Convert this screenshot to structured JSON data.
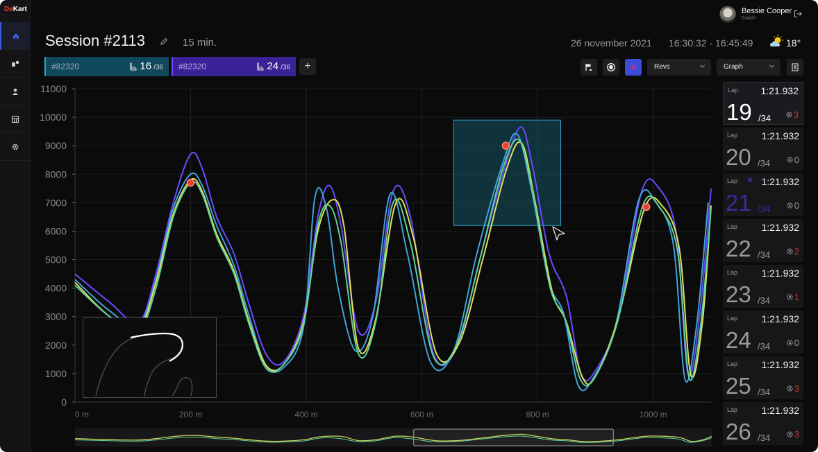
{
  "app": {
    "logo_main": "De",
    "logo_accent": "Kart"
  },
  "sidebar": {
    "items": [
      {
        "name": "home",
        "active": true
      },
      {
        "name": "karts",
        "active": false
      },
      {
        "name": "drivers",
        "active": false
      },
      {
        "name": "calendar",
        "active": false
      },
      {
        "name": "settings",
        "active": false
      }
    ]
  },
  "user": {
    "name": "Bessie Cooper",
    "role": "Coach"
  },
  "header": {
    "title": "Session #2113",
    "duration": "15 min.",
    "date": "26 november 2021",
    "time_range": "16:30:32 - 16:45:49",
    "temperature": "18°"
  },
  "tabs": [
    {
      "id": "#82320",
      "laps_current": "16",
      "laps_total": "/36",
      "color": "#10495e"
    },
    {
      "id": "#82320",
      "laps_current": "24",
      "laps_total": "/36",
      "color": "#3a2397"
    }
  ],
  "toolbar": {
    "metric_select": "Revs",
    "view_select": "Graph"
  },
  "chart_data": {
    "type": "line",
    "xlabel": "",
    "ylabel": "",
    "xlim": [
      0,
      1100
    ],
    "ylim": [
      0,
      11000
    ],
    "x_ticks": [
      "0 m",
      "200 m",
      "400 m",
      "600 m",
      "800 m",
      "1000 m"
    ],
    "x_tick_values": [
      0,
      200,
      400,
      600,
      800,
      1000
    ],
    "y_ticks": [
      "11000",
      "10000",
      "9000",
      "8000",
      "7000",
      "6000",
      "5000",
      "4000",
      "3000",
      "2000",
      "1000",
      "0"
    ],
    "y_tick_values": [
      11000,
      10000,
      9000,
      8000,
      7000,
      6000,
      5000,
      4000,
      3000,
      2000,
      1000,
      0
    ],
    "grid": true,
    "series": [
      {
        "color": "#6a4cff",
        "x": [
          0,
          60,
          110,
          140,
          170,
          200,
          220,
          245,
          275,
          300,
          330,
          360,
          395,
          420,
          440,
          460,
          490,
          520,
          550,
          580,
          620,
          660,
          700,
          740,
          770,
          790,
          820,
          850,
          875,
          900,
          940,
          980,
          1010,
          1040,
          1060,
          1080,
          1100
        ],
        "y": [
          4500,
          3500,
          2800,
          4500,
          7000,
          8700,
          8200,
          6500,
          5200,
          3500,
          1700,
          1400,
          3000,
          6500,
          7600,
          6200,
          2500,
          3500,
          7400,
          6500,
          1700,
          1900,
          5000,
          8000,
          9650,
          8400,
          5200,
          3700,
          1000,
          1100,
          3000,
          7400,
          7500,
          5900,
          1000,
          3000,
          7500
        ]
      },
      {
        "color": "#3fa3d8",
        "x": [
          0,
          60,
          110,
          140,
          170,
          200,
          220,
          245,
          275,
          300,
          330,
          360,
          395,
          415,
          435,
          455,
          485,
          515,
          545,
          575,
          615,
          655,
          695,
          740,
          765,
          790,
          820,
          845,
          870,
          895,
          935,
          975,
          1005,
          1035,
          1055,
          1075,
          1095
        ],
        "y": [
          4300,
          3200,
          2700,
          4300,
          6800,
          8000,
          7600,
          6200,
          4800,
          3100,
          1300,
          1200,
          2600,
          7200,
          6800,
          4000,
          1800,
          3000,
          7300,
          5200,
          1400,
          1800,
          5200,
          8400,
          9400,
          7400,
          4200,
          3100,
          600,
          800,
          2700,
          7100,
          7000,
          5500,
          800,
          2700,
          7000
        ]
      },
      {
        "color": "#e3e05a",
        "x": [
          0,
          60,
          110,
          140,
          170,
          200,
          220,
          245,
          275,
          300,
          330,
          360,
          395,
          420,
          445,
          465,
          490,
          520,
          555,
          585,
          625,
          665,
          705,
          745,
          772,
          795,
          825,
          850,
          878,
          900,
          940,
          985,
          1015,
          1045,
          1065,
          1085,
          1100
        ],
        "y": [
          4200,
          3000,
          2600,
          4200,
          6600,
          7800,
          7400,
          5900,
          4600,
          2900,
          1300,
          1300,
          2800,
          6000,
          7100,
          6200,
          1900,
          2900,
          7000,
          5800,
          1700,
          2100,
          5000,
          8100,
          9100,
          7100,
          3900,
          2800,
          850,
          900,
          3000,
          6800,
          6900,
          5400,
          950,
          2800,
          6900
        ]
      },
      {
        "color": "#5ed39a",
        "x": [
          0,
          60,
          110,
          140,
          170,
          200,
          220,
          245,
          275,
          300,
          330,
          360,
          395,
          420,
          440,
          460,
          490,
          520,
          550,
          580,
          620,
          660,
          700,
          740,
          768,
          792,
          822,
          848,
          874,
          898,
          938,
          982,
          1012,
          1042,
          1062,
          1082,
          1100
        ],
        "y": [
          4100,
          3000,
          2500,
          4000,
          6500,
          7700,
          7300,
          5800,
          4500,
          2800,
          1200,
          1300,
          2700,
          6200,
          6900,
          5600,
          1700,
          2800,
          7000,
          5600,
          1600,
          2000,
          5000,
          8200,
          9200,
          7300,
          4000,
          2900,
          800,
          850,
          2800,
          6900,
          6800,
          5300,
          850,
          2700,
          6800
        ]
      }
    ],
    "markers": [
      {
        "x": 200,
        "y": 7700
      },
      {
        "x": 745,
        "y": 9000
      },
      {
        "x": 988,
        "y": 6850
      }
    ],
    "selection": {
      "x0": 655,
      "x1": 840,
      "y0": 6200,
      "y1": 9900
    }
  },
  "laps": [
    {
      "label": "Lap",
      "time": "1:21.932",
      "number": "19",
      "total": "/34",
      "penalty": "3",
      "state": "current"
    },
    {
      "label": "Lap",
      "time": "1:21.932",
      "number": "20",
      "total": "/34",
      "penalty": "0",
      "state": "normal"
    },
    {
      "label": "Lap",
      "time": "1:21.932",
      "number": "21",
      "total": "/34",
      "penalty": "0",
      "state": "best"
    },
    {
      "label": "Lap",
      "time": "1:21.932",
      "number": "22",
      "total": "/34",
      "penalty": "2",
      "state": "normal"
    },
    {
      "label": "Lap",
      "time": "1:21.932",
      "number": "23",
      "total": "/34",
      "penalty": "1",
      "state": "normal"
    },
    {
      "label": "Lap",
      "time": "1:21.932",
      "number": "24",
      "total": "/34",
      "penalty": "0",
      "state": "normal"
    },
    {
      "label": "Lap",
      "time": "1:21.932",
      "number": "25",
      "total": "/34",
      "penalty": "3",
      "state": "normal"
    },
    {
      "label": "Lap",
      "time": "1:21.932",
      "number": "26",
      "total": "/34",
      "penalty": "3",
      "state": "normal"
    }
  ]
}
